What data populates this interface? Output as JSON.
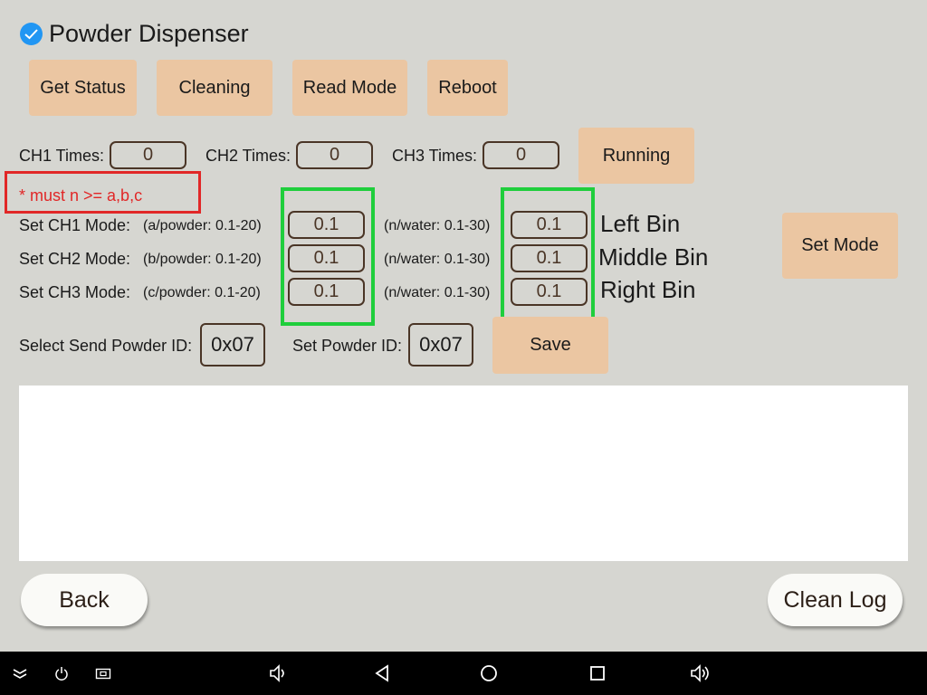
{
  "header": {
    "title": "Powder Dispenser"
  },
  "top_buttons": [
    "Get Status",
    "Cleaning",
    "Read Mode",
    "Reboot"
  ],
  "times": {
    "ch1_label": "CH1 Times:",
    "ch1_value": "0",
    "ch2_label": "CH2 Times:",
    "ch2_value": "0",
    "ch3_label": "CH3 Times:",
    "ch3_value": "0",
    "running_label": "Running"
  },
  "warning": "* must n >= a,b,c",
  "modes": [
    {
      "label": "Set CH1 Mode:",
      "powder_hint": "(a/powder: 0.1-20)",
      "powder_value": "0.1",
      "water_hint": "(n/water: 0.1-30)",
      "water_value": "0.1",
      "bin": "Left Bin"
    },
    {
      "label": "Set CH2 Mode:",
      "powder_hint": "(b/powder: 0.1-20)",
      "powder_value": "0.1",
      "water_hint": "(n/water: 0.1-30)",
      "water_value": "0.1",
      "bin": "Middle Bin"
    },
    {
      "label": "Set CH3 Mode:",
      "powder_hint": "(c/powder: 0.1-20)",
      "powder_value": "0.1",
      "water_hint": "(n/water: 0.1-30)",
      "water_value": "0.1",
      "bin": "Right Bin"
    }
  ],
  "set_mode_label": "Set Mode",
  "ids": {
    "select_label": "Select Send Powder ID:",
    "select_value": "0x07",
    "set_label": "Set Powder ID:",
    "set_value": "0x07",
    "save_label": "Save"
  },
  "log": {
    "text": ""
  },
  "bottom": {
    "back_label": "Back",
    "clean_log_label": "Clean Log"
  },
  "colors": {
    "background": "#d6d6d1",
    "button": "#ebc6a2",
    "warning": "#e12727",
    "highlight": "#1fce3c",
    "field_border": "#4a3526"
  },
  "nav_icons": [
    "chevrons-down-icon",
    "power-icon",
    "screenshot-icon",
    "volume-down-icon",
    "back-icon",
    "home-icon",
    "recents-icon",
    "volume-up-icon"
  ]
}
